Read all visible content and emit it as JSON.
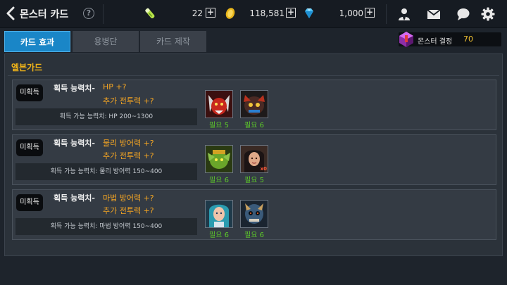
{
  "header": {
    "title": "몬스터 카드",
    "help_label": "?",
    "resources": [
      {
        "icon": "energy-potion-icon",
        "value": "22"
      },
      {
        "icon": "gold-coin-icon",
        "value": "118,581"
      },
      {
        "icon": "diamond-icon",
        "value": "1,000"
      }
    ],
    "plus_label": "+"
  },
  "tabs": [
    {
      "label": "카드 효과",
      "active": true
    },
    {
      "label": "용병단",
      "active": false
    },
    {
      "label": "카드 제작",
      "active": false
    }
  ],
  "crystal": {
    "label": "몬스터 결정",
    "value": "70"
  },
  "section": {
    "title": "엘븐가드"
  },
  "cards": [
    {
      "status": "미획득",
      "gain_label": "획득 능력치-",
      "stat": "HP +?",
      "extra": "추가 전투력 +?",
      "available": "획득 가능 능력치: HP 200~1300",
      "monsters": [
        {
          "icon": "red-demon-card-icon",
          "need": "필요 5"
        },
        {
          "icon": "dark-beast-card-icon",
          "need": "필요 6"
        }
      ]
    },
    {
      "status": "미획득",
      "gain_label": "획득 능력치-",
      "stat": "물리 방어력 +?",
      "extra": "추가 전투력 +?",
      "available": "획득 가능 능력치: 물리 방어력 150~400",
      "monsters": [
        {
          "icon": "green-goblin-card-icon",
          "need": "필요 6"
        },
        {
          "icon": "dark-haired-woman-card-icon",
          "need": "필요 5",
          "mark": "x0"
        }
      ]
    },
    {
      "status": "미획득",
      "gain_label": "획득 능력치-",
      "stat": "마법 방어력 +?",
      "extra": "추가 전투력 +?",
      "available": "획득 가능 능력치: 마법 방어력 150~400",
      "monsters": [
        {
          "icon": "teal-haired-elf-card-icon",
          "need": "필요 6"
        },
        {
          "icon": "blue-skull-warrior-card-icon",
          "need": "필요 6"
        }
      ]
    }
  ]
}
